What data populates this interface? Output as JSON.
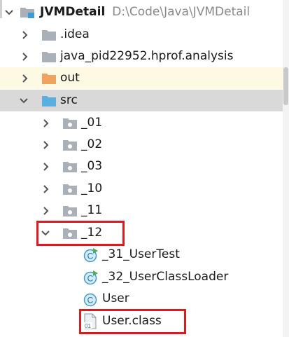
{
  "project": {
    "name": "JVMDetail",
    "path": "D:\\Code\\Java\\JVMDetail"
  },
  "items": {
    "idea": ".idea",
    "analysis": "java_pid22952.hprof.analysis",
    "out": "out",
    "src": "src",
    "p01": "_01",
    "p02": "_02",
    "p03": "_03",
    "p10": "_10",
    "p11": "_11",
    "p12": "_12",
    "c31": "_31_UserTest",
    "c32": "_32_UserClassLoader",
    "user": "User",
    "userclass": "User.class"
  },
  "colors": {
    "folder_gray": "#a9b0b7",
    "folder_orange": "#f0a35e",
    "folder_blue": "#5aaee0",
    "class_icon": "#3d9bd8",
    "run_badge": "#4caf50",
    "selection_outline": "#e0191f"
  }
}
